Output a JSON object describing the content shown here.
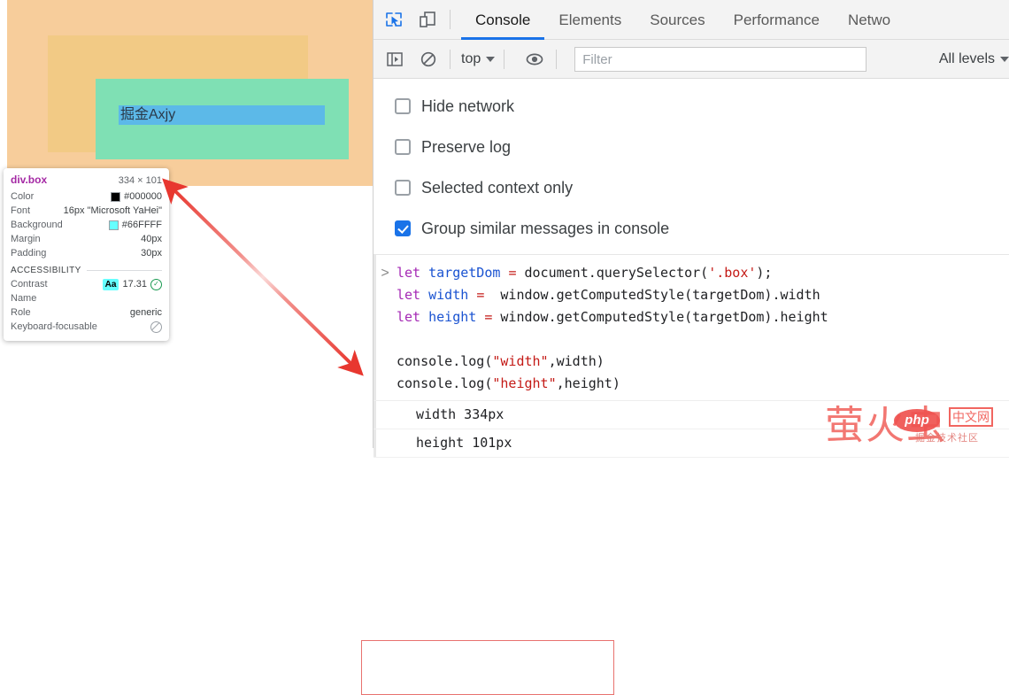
{
  "page": {
    "box_text": "掘金Axjy",
    "box_bg": "#66FFFF",
    "rendered_bg": "#7fe0b4",
    "margin_overlay_color": "#f2ca85",
    "body_overlay_color": "#f7cd9b",
    "text_highlight_color": "#5cb9e8"
  },
  "tooltip": {
    "selector": "div.box",
    "dimensions": "334 × 101",
    "rows": [
      {
        "key": "Color",
        "value": "#000000",
        "swatch": "#000000",
        "has_swatch": true
      },
      {
        "key": "Font",
        "value": "16px \"Microsoft YaHei\"",
        "has_swatch": false
      },
      {
        "key": "Background",
        "value": "#66FFFF",
        "swatch": "#66FFFF",
        "has_swatch": true
      },
      {
        "key": "Margin",
        "value": "40px",
        "has_swatch": false
      },
      {
        "key": "Padding",
        "value": "30px",
        "has_swatch": false
      }
    ],
    "accessibility_label": "ACCESSIBILITY",
    "a11y": {
      "contrast_key": "Contrast",
      "contrast_chip": "Aa",
      "contrast_value": "17.31",
      "contrast_status_icon": "check-circle-icon",
      "name_key": "Name",
      "name_value": "",
      "role_key": "Role",
      "role_value": "generic",
      "keyboard_key": "Keyboard-focusable",
      "keyboard_status_icon": "not-allowed-icon"
    }
  },
  "devtools": {
    "toolbar_icons": [
      {
        "name": "inspect-element-icon",
        "active": true
      },
      {
        "name": "device-toolbar-icon",
        "active": false
      }
    ],
    "tabs": [
      {
        "label": "Console",
        "active": true
      },
      {
        "label": "Elements",
        "active": false
      },
      {
        "label": "Sources",
        "active": false
      },
      {
        "label": "Performance",
        "active": false
      },
      {
        "label": "Netwo",
        "active": false
      }
    ],
    "filterbar": {
      "icons": [
        {
          "name": "console-sidebar-icon"
        },
        {
          "name": "clear-console-icon"
        },
        {
          "name": "eye-icon"
        }
      ],
      "context": "top",
      "filter_placeholder": "Filter",
      "filter_value": "",
      "levels": "All levels"
    },
    "settings": [
      {
        "label": "Hide network",
        "checked": false
      },
      {
        "label": "Preserve log",
        "checked": false
      },
      {
        "label": "Selected context only",
        "checked": false
      },
      {
        "label": "Group similar messages in console",
        "checked": true
      }
    ],
    "console": {
      "prompt_symbol": ">",
      "code_lines": [
        "let targetDom = document.querySelector('.box');",
        "let width =  window.getComputedStyle(targetDom).width",
        "let height = window.getComputedStyle(targetDom).height",
        "",
        "console.log(\"width\",width)",
        "console.log(\"height\",height)"
      ],
      "outputs": [
        "width 334px",
        "height 101px"
      ]
    }
  },
  "annotation": {
    "arrow_color": "#e8372f",
    "highlight_box_color": "#e8726f"
  },
  "watermark": {
    "main": "萤火虫",
    "badge": "php",
    "suffix": "中文网",
    "sub": "掘金技术社区"
  }
}
